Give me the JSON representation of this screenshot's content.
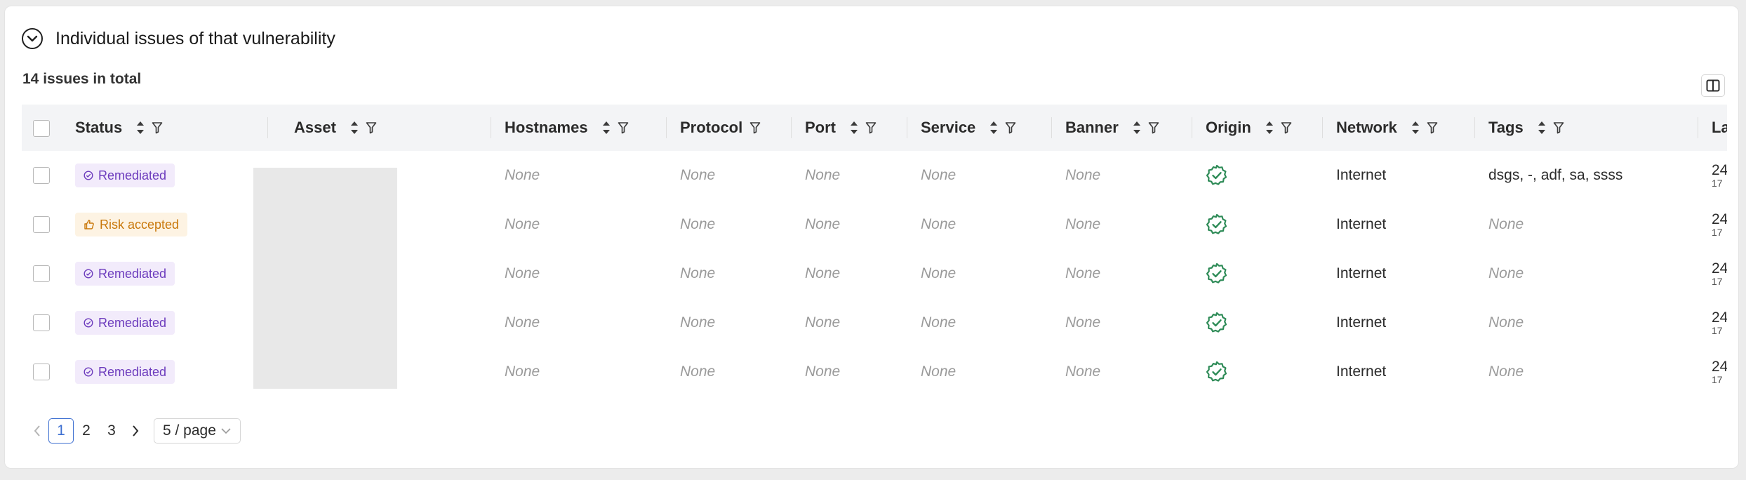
{
  "section": {
    "title": "Individual issues of that vulnerability",
    "summary": "14 issues in total"
  },
  "table": {
    "columns": [
      {
        "label": "Status",
        "sortable": true,
        "filterable": true
      },
      {
        "label": "Asset",
        "sortable": true,
        "filterable": true
      },
      {
        "label": "Hostnames",
        "sortable": true,
        "filterable": true
      },
      {
        "label": "Protocol",
        "sortable": false,
        "filterable": true
      },
      {
        "label": "Port",
        "sortable": true,
        "filterable": true
      },
      {
        "label": "Service",
        "sortable": true,
        "filterable": true
      },
      {
        "label": "Banner",
        "sortable": true,
        "filterable": true
      },
      {
        "label": "Origin",
        "sortable": true,
        "filterable": true
      },
      {
        "label": "Network",
        "sortable": true,
        "filterable": true
      },
      {
        "label": "Tags",
        "sortable": true,
        "filterable": true
      },
      {
        "label": "La",
        "sortable": false,
        "filterable": false
      }
    ],
    "rows": [
      {
        "status": "Remediated",
        "status_type": "remediated",
        "hostnames": "None",
        "protocol": "None",
        "port": "None",
        "service": "None",
        "banner": "None",
        "origin_icon": "verified-badge-icon",
        "network": "Internet",
        "tags": "dsgs, -, adf, sa, ssss",
        "last_top": "24",
        "last_bottom": "17"
      },
      {
        "status": "Risk accepted",
        "status_type": "risk",
        "hostnames": "None",
        "protocol": "None",
        "port": "None",
        "service": "None",
        "banner": "None",
        "origin_icon": "verified-badge-icon",
        "network": "Internet",
        "tags": "None",
        "last_top": "24",
        "last_bottom": "17"
      },
      {
        "status": "Remediated",
        "status_type": "remediated",
        "hostnames": "None",
        "protocol": "None",
        "port": "None",
        "service": "None",
        "banner": "None",
        "origin_icon": "verified-badge-icon",
        "network": "Internet",
        "tags": "None",
        "last_top": "24",
        "last_bottom": "17"
      },
      {
        "status": "Remediated",
        "status_type": "remediated",
        "hostnames": "None",
        "protocol": "None",
        "port": "None",
        "service": "None",
        "banner": "None",
        "origin_icon": "verified-badge-icon",
        "network": "Internet",
        "tags": "None",
        "last_top": "24",
        "last_bottom": "17"
      },
      {
        "status": "Remediated",
        "status_type": "remediated",
        "hostnames": "None",
        "protocol": "None",
        "port": "None",
        "service": "None",
        "banner": "None",
        "origin_icon": "verified-badge-icon",
        "network": "Internet",
        "tags": "None",
        "last_top": "24",
        "last_bottom": "17"
      }
    ]
  },
  "pagination": {
    "pages": [
      "1",
      "2",
      "3"
    ],
    "current": "1",
    "page_size": "5 / page"
  },
  "colors": {
    "remediated_bg": "#f2ebfb",
    "remediated_text": "#6c3bbd",
    "risk_bg": "#fdf3e3",
    "risk_text": "#c9780a",
    "origin_green": "#2e8b57",
    "pagination_active": "#3d6fd1"
  }
}
